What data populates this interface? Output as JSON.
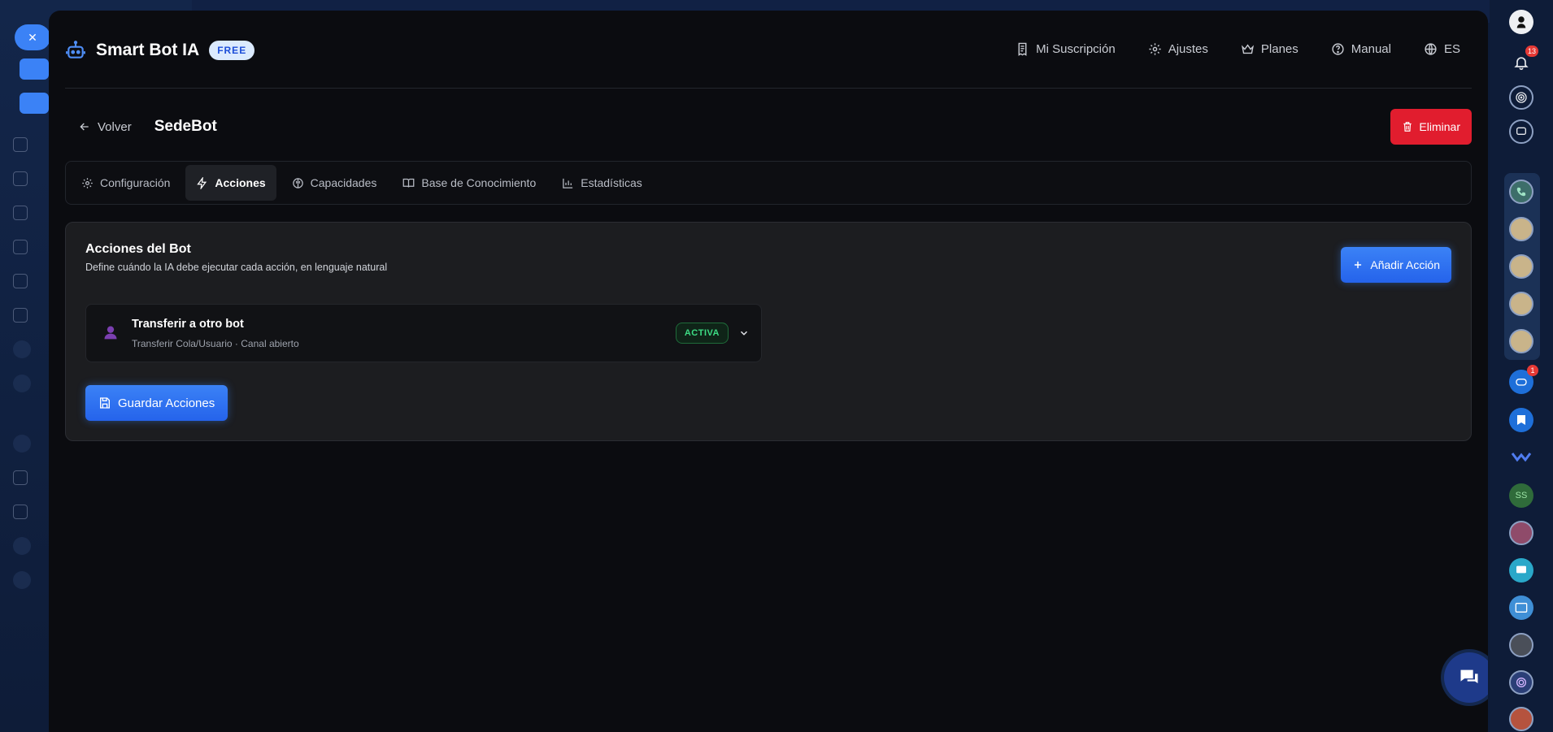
{
  "header": {
    "title": "Smart Bot IA",
    "plan_badge": "FREE",
    "nav": [
      {
        "label": "Mi Suscripción",
        "icon": "receipt-icon"
      },
      {
        "label": "Ajustes",
        "icon": "gear-icon"
      },
      {
        "label": "Planes",
        "icon": "crown-icon"
      },
      {
        "label": "Manual",
        "icon": "help-circle-icon"
      },
      {
        "label": "ES",
        "icon": "globe-icon"
      }
    ]
  },
  "subheader": {
    "back_label": "Volver",
    "bot_name": "SedeBot",
    "delete_label": "Eliminar"
  },
  "tabs": [
    {
      "label": "Configuración",
      "icon": "gear-icon",
      "active": false
    },
    {
      "label": "Acciones",
      "icon": "lightning-icon",
      "active": true
    },
    {
      "label": "Capacidades",
      "icon": "brain-icon",
      "active": false
    },
    {
      "label": "Base de Conocimiento",
      "icon": "book-icon",
      "active": false
    },
    {
      "label": "Estadísticas",
      "icon": "bar-chart-icon",
      "active": false
    }
  ],
  "actions_card": {
    "title": "Acciones del Bot",
    "subtitle": "Define cuándo la IA debe ejecutar cada acción, en lenguaje natural",
    "add_label": "Añadir Acción",
    "save_label": "Guardar Acciones",
    "items": [
      {
        "title": "Transferir a otro bot",
        "subtitle": "Transferir Cola/Usuario · Canal abierto",
        "status": "ACTIVA",
        "icon": "user-silhouette-icon"
      }
    ]
  },
  "right_rail": {
    "notification_count": "13",
    "chat_badge_count": "1",
    "initials": "SS"
  },
  "colors": {
    "accent": "#3b82f6",
    "danger": "#e11d2e",
    "success": "#3ddc84",
    "modal_bg": "#0b0c10",
    "card_bg": "#1c1d20"
  }
}
